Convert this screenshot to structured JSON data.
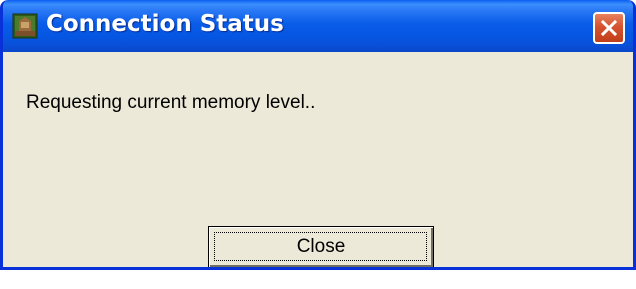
{
  "window": {
    "title": "Connection Status",
    "title_icon": "app-icon",
    "close_icon": "close-icon"
  },
  "content": {
    "message": "Requesting current memory level.."
  },
  "buttons": {
    "close_label": "Close"
  },
  "colors": {
    "titlebar": "#0a5de8",
    "window_border": "#0831d9",
    "body_bg": "#ece9d8",
    "close_button": "#d6532f"
  }
}
